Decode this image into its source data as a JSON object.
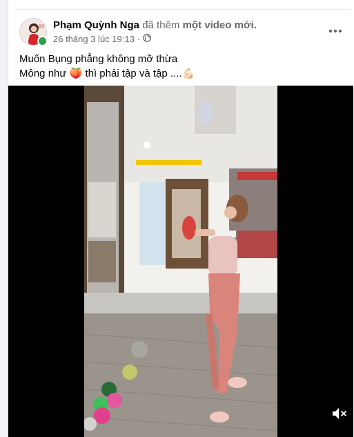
{
  "post": {
    "author_name": "Phạm Quỳnh Nga",
    "action_prefix": "đã thêm",
    "action_strong": "một video mới.",
    "timestamp": "26 tháng 3 lúc 19:13",
    "audience_icon": "globe-icon",
    "text_line1": "Muốn Bụng phẳng không mỡ thừa",
    "text_line2_before": "Mông như",
    "text_line2_emoji1": "🍑",
    "text_line2_after": "thì phải tập và tập ....",
    "text_line2_emoji2": "💪🏻"
  },
  "video": {
    "mute_icon": "speaker-muted-icon"
  },
  "colors": {
    "background": "#f0f2f5",
    "card": "#ffffff",
    "primary_text": "#050505",
    "secondary_text": "#65676b",
    "online": "#31a24c"
  }
}
